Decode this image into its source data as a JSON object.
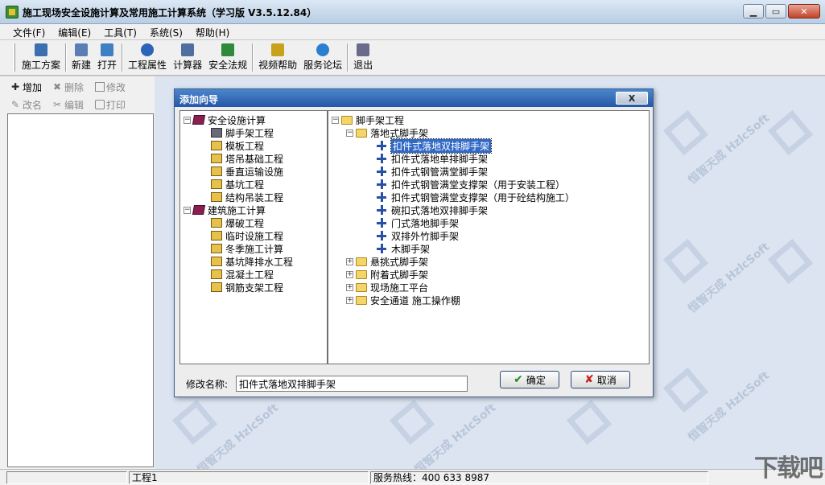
{
  "window": {
    "title": "施工现场安全设施计算及常用施工计算系统（学习版 V3.5.12.84）",
    "minimize": "▁",
    "maximize": "▭",
    "close": "✕"
  },
  "menu": [
    "文件(F)",
    "编辑(E)",
    "工具(T)",
    "系统(S)",
    "帮助(H)"
  ],
  "toolbar": [
    {
      "label": "施工方案",
      "icon": "document-list-icon",
      "color": "#3c6fb0"
    },
    {
      "label": "新建",
      "icon": "new-file-icon",
      "color": "#5a7fb5"
    },
    {
      "label": "打开",
      "icon": "open-icon",
      "color": "#3f7fc4"
    },
    {
      "label": "工程属性",
      "icon": "info-icon",
      "color": "#2a63b8"
    },
    {
      "label": "计算器",
      "icon": "calculator-icon",
      "color": "#4f6fa0"
    },
    {
      "label": "安全法规",
      "icon": "regulations-icon",
      "color": "#2f8a3a"
    },
    {
      "label": "视频帮助",
      "icon": "help-video-icon",
      "color": "#c7a21a"
    },
    {
      "label": "服务论坛",
      "icon": "forum-globe-icon",
      "color": "#2a7fd0"
    },
    {
      "label": "退出",
      "icon": "exit-icon",
      "color": "#6a6a8a"
    }
  ],
  "left_panel": {
    "add": "增加",
    "delete": "删除",
    "modify": "修改",
    "rename": "改名",
    "edit": "编辑",
    "print": "打印"
  },
  "dialog": {
    "title": "添加向导",
    "close": "X",
    "left_tree": [
      {
        "label": "安全设施计算",
        "level": 0,
        "type": "book",
        "expander": "−"
      },
      {
        "label": "脚手架工程",
        "level": 1,
        "type": "item"
      },
      {
        "label": "模板工程",
        "level": 1,
        "type": "item"
      },
      {
        "label": "塔吊基础工程",
        "level": 1,
        "type": "item"
      },
      {
        "label": "垂直运输设施",
        "level": 1,
        "type": "item"
      },
      {
        "label": "基坑工程",
        "level": 1,
        "type": "item"
      },
      {
        "label": "结构吊装工程",
        "level": 1,
        "type": "item"
      },
      {
        "label": "建筑施工计算",
        "level": 0,
        "type": "book",
        "expander": "−"
      },
      {
        "label": "爆破工程",
        "level": 1,
        "type": "item"
      },
      {
        "label": "临时设施工程",
        "level": 1,
        "type": "item"
      },
      {
        "label": "冬季施工计算",
        "level": 1,
        "type": "item"
      },
      {
        "label": "基坑降排水工程",
        "level": 1,
        "type": "item"
      },
      {
        "label": "混凝土工程",
        "level": 1,
        "type": "item"
      },
      {
        "label": "钢筋支架工程",
        "level": 1,
        "type": "item"
      }
    ],
    "right_tree": [
      {
        "label": "脚手架工程",
        "level": 0,
        "type": "folder",
        "expander": "−"
      },
      {
        "label": "落地式脚手架",
        "level": 1,
        "type": "folder",
        "expander": "−"
      },
      {
        "label": "扣件式落地双排脚手架",
        "level": 2,
        "type": "leaf",
        "selected": true
      },
      {
        "label": "扣件式落地单排脚手架",
        "level": 2,
        "type": "leaf"
      },
      {
        "label": "扣件式钢管满堂脚手架",
        "level": 2,
        "type": "leaf"
      },
      {
        "label": "扣件式钢管满堂支撑架（用于安装工程）",
        "level": 2,
        "type": "leaf"
      },
      {
        "label": "扣件式钢管满堂支撑架（用于砼结构施工）",
        "level": 2,
        "type": "leaf"
      },
      {
        "label": "碗扣式落地双排脚手架",
        "level": 2,
        "type": "leaf"
      },
      {
        "label": "门式落地脚手架",
        "level": 2,
        "type": "leaf"
      },
      {
        "label": "双排外竹脚手架",
        "level": 2,
        "type": "leaf"
      },
      {
        "label": "木脚手架",
        "level": 2,
        "type": "leaf"
      },
      {
        "label": "悬挑式脚手架",
        "level": 1,
        "type": "folder",
        "expander": "+"
      },
      {
        "label": "附着式脚手架",
        "level": 1,
        "type": "folder",
        "expander": "+"
      },
      {
        "label": "现场施工平台",
        "level": 1,
        "type": "folder",
        "expander": "+"
      },
      {
        "label": "安全通道 施工操作棚",
        "level": 1,
        "type": "folder",
        "expander": "+"
      }
    ],
    "rename_label": "修改名称:",
    "rename_value": "扣件式落地双排脚手架",
    "ok": "确定",
    "cancel": "取消"
  },
  "statusbar": {
    "project": "工程1",
    "hotline": "服务热线：400 633 8987"
  },
  "watermark": {
    "text": "恒智天成 HzlcSoft",
    "corner_logo": "下载吧"
  }
}
